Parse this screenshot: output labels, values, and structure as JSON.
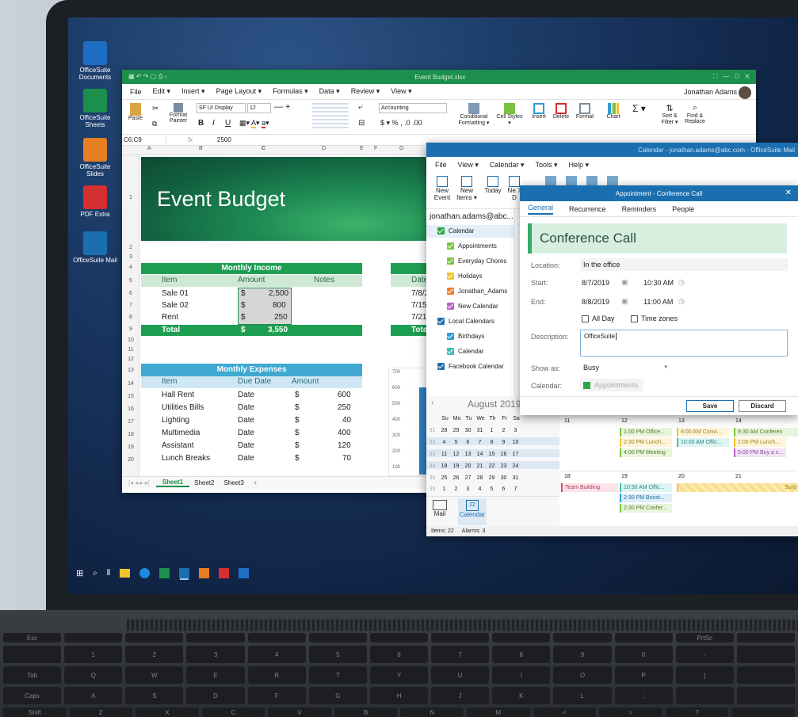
{
  "desktop": {
    "icons": [
      {
        "label": "OfficeSuite Documents",
        "icon": "documents-icon",
        "color": "#1e6fc4"
      },
      {
        "label": "OfficeSuite Sheets",
        "icon": "sheets-icon",
        "color": "#1b8f4b"
      },
      {
        "label": "OfficeSuite Slides",
        "icon": "slides-icon",
        "color": "#e67e22"
      },
      {
        "label": "PDF Extra",
        "icon": "pdf-icon",
        "color": "#d62f2f"
      },
      {
        "label": "OfficeSuite Mail",
        "icon": "mail-icon",
        "color": "#1a6fb0"
      }
    ]
  },
  "sheets": {
    "title": "Event Budget.xlsx",
    "menu": [
      "File",
      "Edit ▾",
      "Insert ▾",
      "Page Layout ▾",
      "Formulas ▾",
      "Data ▾",
      "Review ▾",
      "View ▾"
    ],
    "user": "Jonathan Adams",
    "ribbon": {
      "paste": "Paste",
      "format_painter": "Format Painter",
      "font": "SF UI Display",
      "size": "12",
      "number_format": "Accounting",
      "conditional": "Conditional Formatting ▾",
      "cell_styles": "Cell Styles ▾",
      "insert": "Insert",
      "delete": "Delete",
      "format": "Format",
      "chart": "Chart",
      "sort": "Sort & Filter ▾",
      "find": "Find & Replace",
      "bold": "B",
      "italic": "I",
      "underline": "U",
      "currency": "$ ▾",
      "percent": "%",
      "comma": ","
    },
    "name_box": "C6:C9",
    "formula": "2500",
    "fx": "fx",
    "columns": [
      "A",
      "B",
      "C",
      "D",
      "E",
      "F",
      "G"
    ],
    "rows": [
      "1",
      "2",
      "3",
      "4",
      "5",
      "6",
      "7",
      "8",
      "9",
      "10",
      "11",
      "12",
      "13",
      "14",
      "15",
      "16",
      "17",
      "18",
      "19",
      "20"
    ],
    "banner_title": "Event Budget",
    "income": {
      "title": "Monthly Income",
      "headers": [
        "Item",
        "Amount",
        "Notes"
      ],
      "rows": [
        {
          "item": "Sale 01",
          "cur": "$",
          "amt": "2,500"
        },
        {
          "item": "Sale 02",
          "cur": "$",
          "amt": "800"
        },
        {
          "item": "Rent",
          "cur": "$",
          "amt": "250"
        }
      ],
      "total": {
        "item": "Total",
        "cur": "$",
        "amt": "3,550"
      }
    },
    "dates": {
      "header": "Date",
      "rows": [
        "7/8/2",
        "7/15/",
        "7/21/"
      ],
      "total": "Tota"
    },
    "expenses": {
      "title": "Monthly Expenses",
      "headers": [
        "Item",
        "Due Date",
        "Amount"
      ],
      "rows": [
        {
          "item": "Hall Rent",
          "due": "Date",
          "cur": "$",
          "amt": "600"
        },
        {
          "item": "Utilities Bills",
          "due": "Date",
          "cur": "$",
          "amt": "250"
        },
        {
          "item": "Lighting",
          "due": "Date",
          "cur": "$",
          "amt": "40"
        },
        {
          "item": "Multimedia",
          "due": "Date",
          "cur": "$",
          "amt": "400"
        },
        {
          "item": "Assistant",
          "due": "Date",
          "cur": "$",
          "amt": "120"
        },
        {
          "item": "Lunch Breaks",
          "due": "Date",
          "cur": "$",
          "amt": "70"
        }
      ]
    },
    "chart_ticks": [
      "700",
      "600",
      "500",
      "400",
      "300",
      "200",
      "100"
    ],
    "tabs": [
      "Sheet1",
      "Sheet2",
      "Sheet3"
    ]
  },
  "mail": {
    "title": "Calendar - jonathan.adams@abc.com - OfficeSuite Mail",
    "menu": [
      "File",
      "View ▾",
      "Calendar ▾",
      "Tools ▾",
      "Help ▾"
    ],
    "toolbar": [
      "New Event",
      "New Items ▾",
      "Today",
      "Ne 7 D"
    ],
    "account": "jonathan.adams@abc...",
    "calendar_root": "Calendar",
    "calendars": [
      {
        "label": "Appointments",
        "color": "#7cc242"
      },
      {
        "label": "Everyday Chores",
        "color": "#7cc242"
      },
      {
        "label": "Holidays",
        "color": "#f2c12e"
      },
      {
        "label": "Jonathan_Adams",
        "color": "#f07f2e"
      },
      {
        "label": "New Calendar",
        "color": "#b565c9"
      }
    ],
    "local_root": "Local Calendars",
    "local": [
      {
        "label": "Birthdays",
        "color": "#2f9bd6"
      },
      {
        "label": "Calendar",
        "color": "#3cbfb4"
      }
    ],
    "facebook": "Facebook Calendar",
    "mini": {
      "month": "August 2019",
      "days": [
        "Su",
        "Mo",
        "Tu",
        "We",
        "Th",
        "Fr",
        "Sa"
      ],
      "weeks": [
        {
          "n": "31",
          "d": [
            "28",
            "29",
            "30",
            "31",
            "1",
            "2",
            "3"
          ]
        },
        {
          "n": "32",
          "d": [
            "4",
            "5",
            "6",
            "7",
            "8",
            "9",
            "10"
          ]
        },
        {
          "n": "33",
          "d": [
            "11",
            "12",
            "13",
            "14",
            "15",
            "16",
            "17"
          ]
        },
        {
          "n": "34",
          "d": [
            "18",
            "19",
            "20",
            "21",
            "22",
            "23",
            "24"
          ]
        },
        {
          "n": "35",
          "d": [
            "25",
            "26",
            "27",
            "28",
            "29",
            "30",
            "31"
          ]
        },
        {
          "n": "36",
          "d": [
            "1",
            "2",
            "3",
            "4",
            "5",
            "6",
            "7"
          ]
        }
      ]
    },
    "week1": [
      "11",
      "12",
      "13",
      "14"
    ],
    "week2": [
      "18",
      "19",
      "20",
      "21"
    ],
    "events1": [
      {
        "text": "1:00 PM Office...",
        "col": 1,
        "row": 0,
        "color": "#7cc242"
      },
      {
        "text": "2:30 PM Lunch...",
        "col": 1,
        "row": 1,
        "color": "#f2c12e"
      },
      {
        "text": "4:00 PM Meeting",
        "col": 1,
        "row": 2,
        "color": "#7cc242"
      },
      {
        "text": "8:00 AM Corwi...",
        "col": 2,
        "row": 0,
        "color": "#f2c12e"
      },
      {
        "text": "10:00 AM Offic...",
        "col": 2,
        "row": 1,
        "color": "#3cbfb4"
      },
      {
        "text": "9:30 AM   Conferen",
        "col": 3,
        "row": 0,
        "color": "#7cc242"
      },
      {
        "text": "1:00 PM Lunch...",
        "col": 3,
        "row": 1,
        "color": "#f2c12e"
      },
      {
        "text": "5:00 PM Buy a s...",
        "col": 3,
        "row": 2,
        "color": "#b565c9"
      }
    ],
    "events2": [
      {
        "text": "Team Building",
        "col": 0,
        "row": 0,
        "color": "#d94b6a"
      },
      {
        "text": "10:30 AM Offic...",
        "col": 1,
        "row": 0,
        "color": "#3cbfb4"
      },
      {
        "text": "2:30 PM Boost...",
        "col": 1,
        "row": 1,
        "color": "#2f9bd6"
      },
      {
        "text": "2:30 PM Confer...",
        "col": 1,
        "row": 2,
        "color": "#7cc242"
      }
    ],
    "span_label": "Surp",
    "bottom_nav": [
      {
        "label": "Mail",
        "icon": "mail-icon"
      },
      {
        "label": "Calendar",
        "icon": "calendar-icon",
        "badge": "22"
      }
    ],
    "status": {
      "items": "Items: 22",
      "alarms": "Alarms: 3"
    }
  },
  "appointment": {
    "title": "Appointment - Conference Call",
    "tabs": [
      "General",
      "Recurrence",
      "Reminders",
      "People"
    ],
    "subject": "Conference Call",
    "location_label": "Location:",
    "location": "In the office",
    "start_label": "Start:",
    "start_date": "8/7/2019",
    "start_time": "10:30 AM",
    "end_label": "End:",
    "end_date": "8/8/2019",
    "end_time": "11:00 AM",
    "all_day": "All Day",
    "time_zones": "Time zones",
    "description_label": "Description:",
    "description": "OfficeSuite",
    "showas_label": "Show as:",
    "showas": "Busy",
    "calendar_label": "Calendar:",
    "calendar": "Appointments",
    "save": "Save",
    "discard": "Discard",
    "accent": "#3aa868"
  },
  "taskbar": {
    "icons": [
      "start-icon",
      "search-icon",
      "task-view-icon",
      "file-explorer-icon",
      "skype-icon",
      "sheets-icon",
      "mail-icon",
      "slides-icon",
      "pdf-icon",
      "documents-icon"
    ]
  },
  "keyboard": {
    "row1": [
      "Esc",
      "",
      "",
      "",
      "",
      "",
      "",
      "",
      "",
      "",
      "",
      "PrtSc",
      ""
    ],
    "row2": [
      "",
      "1",
      "2",
      "3",
      "4",
      "5",
      "6",
      "7",
      "8",
      "9",
      "0",
      "-",
      ""
    ],
    "row3": [
      "Tab",
      "Q",
      "W",
      "E",
      "R",
      "T",
      "Y",
      "U",
      "I",
      "O",
      "P",
      "[",
      ""
    ],
    "row4": [
      "Caps",
      "A",
      "S",
      "D",
      "F",
      "G",
      "H",
      "J",
      "K",
      "L",
      ";",
      "",
      ""
    ],
    "row5": [
      "Shift",
      "Z",
      "X",
      "C",
      "V",
      "B",
      "N",
      "M",
      "<",
      ">",
      "?",
      ""
    ]
  }
}
